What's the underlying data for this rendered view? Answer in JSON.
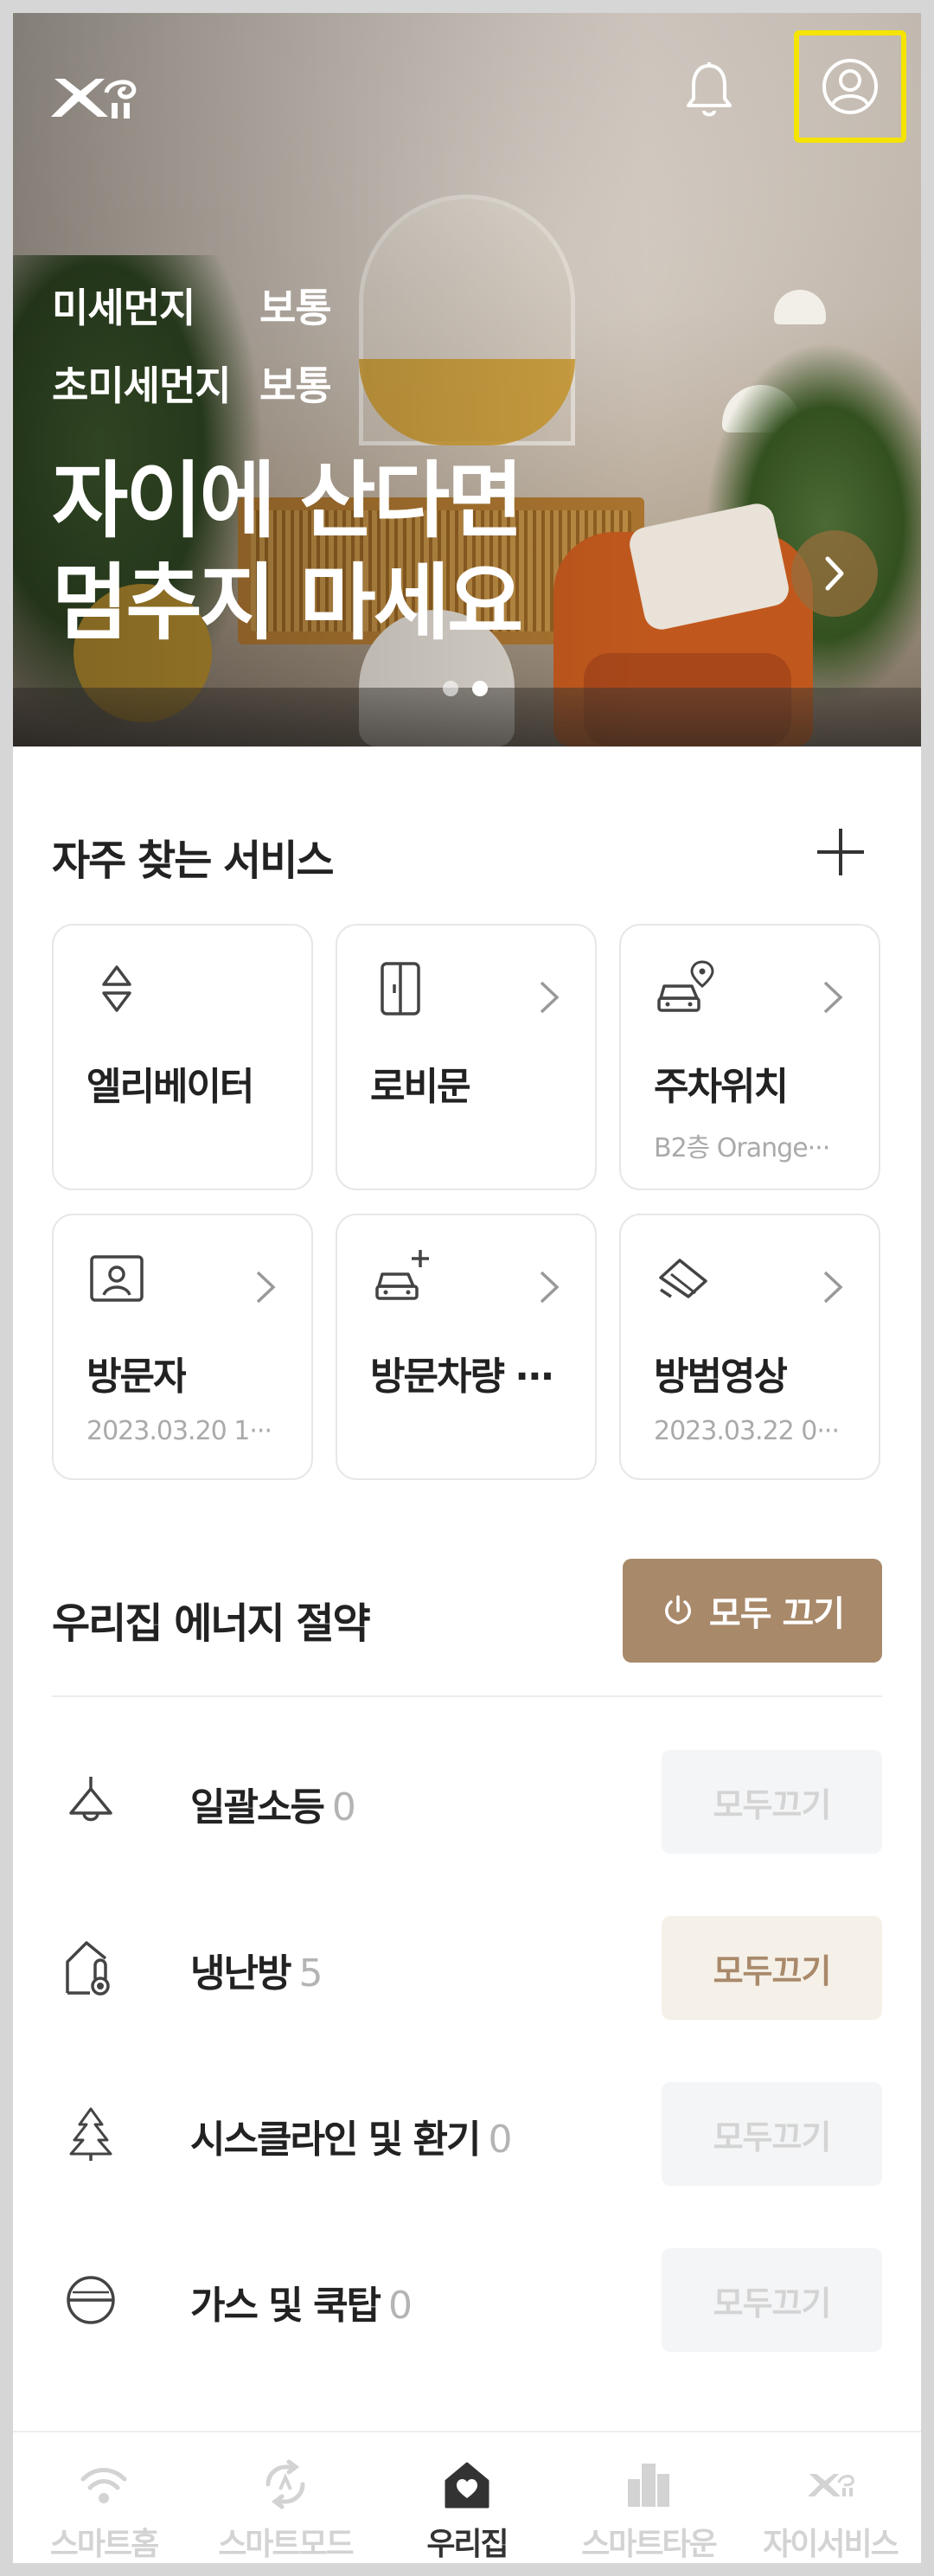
{
  "header": {
    "logo_text": "Xi",
    "notification_icon": "bell-icon",
    "profile_icon": "user-circle-icon"
  },
  "hero": {
    "air": [
      {
        "label": "미세먼지",
        "value": "보통"
      },
      {
        "label": "초미세먼지",
        "value": "보통"
      }
    ],
    "title_line1": "자이에 산다면",
    "title_line2": "멈추지 마세요",
    "slide_index": 2,
    "slide_total": 2
  },
  "services": {
    "title": "자주 찾는 서비스",
    "items": [
      {
        "label": "엘리베이터",
        "sub": "",
        "icon": "elevator-updown-icon"
      },
      {
        "label": "로비문",
        "sub": "",
        "icon": "door-icon"
      },
      {
        "label": "주차위치",
        "sub": "B2층 Orange···",
        "icon": "car-location-icon"
      },
      {
        "label": "방문자",
        "sub": "2023.03.20 1···",
        "icon": "visitor-photo-icon"
      },
      {
        "label": "방문차량 ···",
        "sub": "",
        "icon": "car-add-icon"
      },
      {
        "label": "방범영상",
        "sub": "2023.03.22 0···",
        "icon": "cctv-icon"
      }
    ]
  },
  "energy": {
    "title": "우리집 에너지 절약",
    "all_off_label": "모두 끄기",
    "rows": [
      {
        "name": "일괄소등",
        "count": "0",
        "button": "모두끄기",
        "active": false,
        "icon": "ceiling-lamp-icon"
      },
      {
        "name": "냉난방",
        "count": "5",
        "button": "모두끄기",
        "active": true,
        "icon": "thermometer-house-icon"
      },
      {
        "name": "시스클라인 및 환기",
        "count": "0",
        "button": "모두끄기",
        "active": false,
        "icon": "tree-ventilation-icon"
      },
      {
        "name": "가스 및 쿡탑",
        "count": "0",
        "button": "모두끄기",
        "active": false,
        "icon": "gas-valve-icon"
      }
    ]
  },
  "bottom_nav": [
    {
      "label": "스마트홈",
      "icon": "wifi-home-icon",
      "active": false
    },
    {
      "label": "스마트모드",
      "icon": "mode-icon",
      "active": false
    },
    {
      "label": "우리집",
      "icon": "house-heart-icon",
      "active": true
    },
    {
      "label": "스마트타운",
      "icon": "buildings-icon",
      "active": false
    },
    {
      "label": "자이서비스",
      "icon": "xi-logo-icon",
      "active": false
    }
  ],
  "colors": {
    "accent": "#a8896a",
    "accent_light": "#f5f0e8",
    "highlight_border": "#f4e400"
  }
}
